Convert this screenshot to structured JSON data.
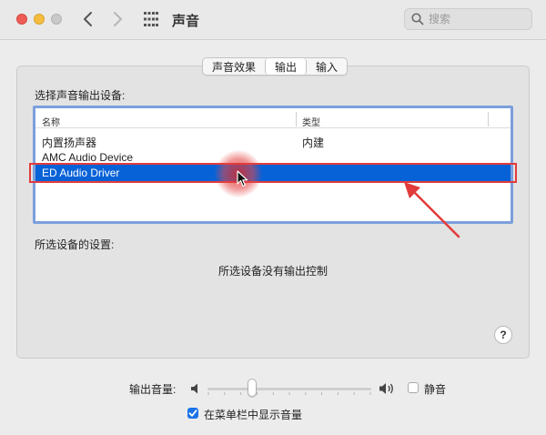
{
  "window": {
    "title": "声音",
    "search_placeholder": "搜索"
  },
  "tabs": [
    {
      "label": "声音效果",
      "active": false
    },
    {
      "label": "输出",
      "active": true
    },
    {
      "label": "输入",
      "active": false
    }
  ],
  "output": {
    "section_label": "选择声音输出设备:",
    "columns": {
      "name": "名称",
      "type": "类型"
    },
    "devices": [
      {
        "name": "内置扬声器",
        "type": "内建",
        "selected": false
      },
      {
        "name": "AMC Audio Device",
        "type": "",
        "selected": false
      },
      {
        "name": "ED Audio Driver",
        "type": "",
        "selected": true
      }
    ],
    "settings_label": "所选设备的设置:",
    "no_control_text": "所选设备没有输出控制",
    "help_label": "?"
  },
  "volume": {
    "label": "输出音量:",
    "level": 0.27,
    "mute_label": "静音",
    "muted": false,
    "show_in_menubar_label": "在菜单栏中显示音量",
    "show_in_menubar": true
  },
  "colors": {
    "selection": "#0862d7",
    "list_focus_ring": "#7c9fdc",
    "annotation": "#e23b3b"
  }
}
